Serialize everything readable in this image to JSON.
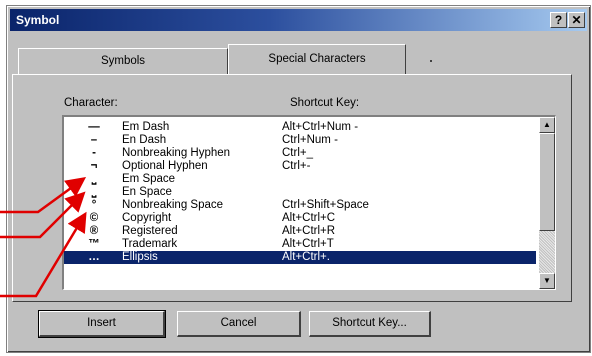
{
  "window": {
    "title": "Symbol",
    "help": "?",
    "close": "✕"
  },
  "tabs": [
    {
      "label": "Symbols"
    },
    {
      "label": "Special Characters"
    }
  ],
  "columns": {
    "character": "Character:",
    "shortcut": "Shortcut Key:"
  },
  "rows": [
    {
      "symbol": "—",
      "name": "Em Dash",
      "shortcut": "Alt+Ctrl+Num -"
    },
    {
      "symbol": "–",
      "name": "En Dash",
      "shortcut": "Ctrl+Num -"
    },
    {
      "symbol": "-",
      "name": "Nonbreaking Hyphen",
      "shortcut": "Ctrl+_"
    },
    {
      "symbol": "¬",
      "name": "Optional Hyphen",
      "shortcut": "Ctrl+-"
    },
    {
      "symbol": "⎵",
      "name": "Em Space",
      "shortcut": ""
    },
    {
      "symbol": "⎵",
      "name": "En Space",
      "shortcut": ""
    },
    {
      "symbol": "°",
      "name": "Nonbreaking Space",
      "shortcut": "Ctrl+Shift+Space"
    },
    {
      "symbol": "©",
      "name": "Copyright",
      "shortcut": "Alt+Ctrl+C"
    },
    {
      "symbol": "®",
      "name": "Registered",
      "shortcut": "Alt+Ctrl+R"
    },
    {
      "symbol": "™",
      "name": "Trademark",
      "shortcut": "Alt+Ctrl+T"
    },
    {
      "symbol": "…",
      "name": "Ellipsis",
      "shortcut": "Alt+Ctrl+."
    }
  ],
  "buttons": {
    "insert": "Insert",
    "cancel": "Cancel",
    "shortcut_key": "Shortcut Key..."
  },
  "colors": {
    "title_bar": "#0a246a",
    "selection": "#0a246a",
    "annotation_arrow": "#e00000"
  }
}
